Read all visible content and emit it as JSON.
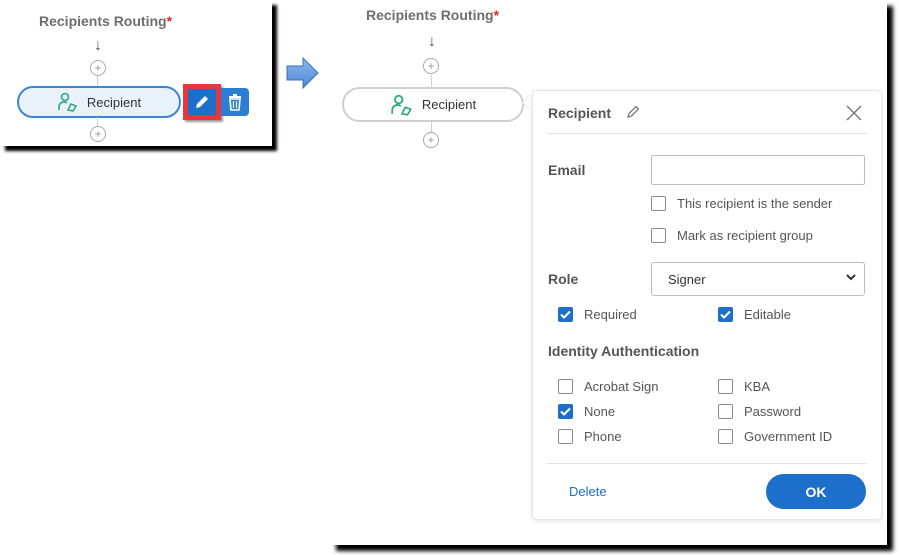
{
  "before": {
    "title": "Recipients Routing",
    "required_mark": "*",
    "node_label": "Recipient",
    "edit_icon": "pencil-icon",
    "delete_icon": "trash-icon"
  },
  "transition_icon": "arrow-right-icon",
  "after": {
    "title": "Recipients Routing",
    "required_mark": "*",
    "node_label": "Recipient"
  },
  "dialog": {
    "title": "Recipient",
    "email_label": "Email",
    "email_value": "",
    "sender_checkbox": {
      "label": "This recipient is the sender",
      "checked": false
    },
    "group_checkbox": {
      "label": "Mark as recipient group",
      "checked": false
    },
    "role_label": "Role",
    "role_value": "Signer",
    "required": {
      "label": "Required",
      "checked": true
    },
    "editable": {
      "label": "Editable",
      "checked": true
    },
    "identity_label": "Identity Authentication",
    "identity_options": [
      {
        "label": "Acrobat Sign",
        "checked": false
      },
      {
        "label": "KBA",
        "checked": false
      },
      {
        "label": "None",
        "checked": true
      },
      {
        "label": "Password",
        "checked": false
      },
      {
        "label": "Phone",
        "checked": false
      },
      {
        "label": "Government ID",
        "checked": false
      }
    ],
    "delete_label": "Delete",
    "ok_label": "OK"
  }
}
